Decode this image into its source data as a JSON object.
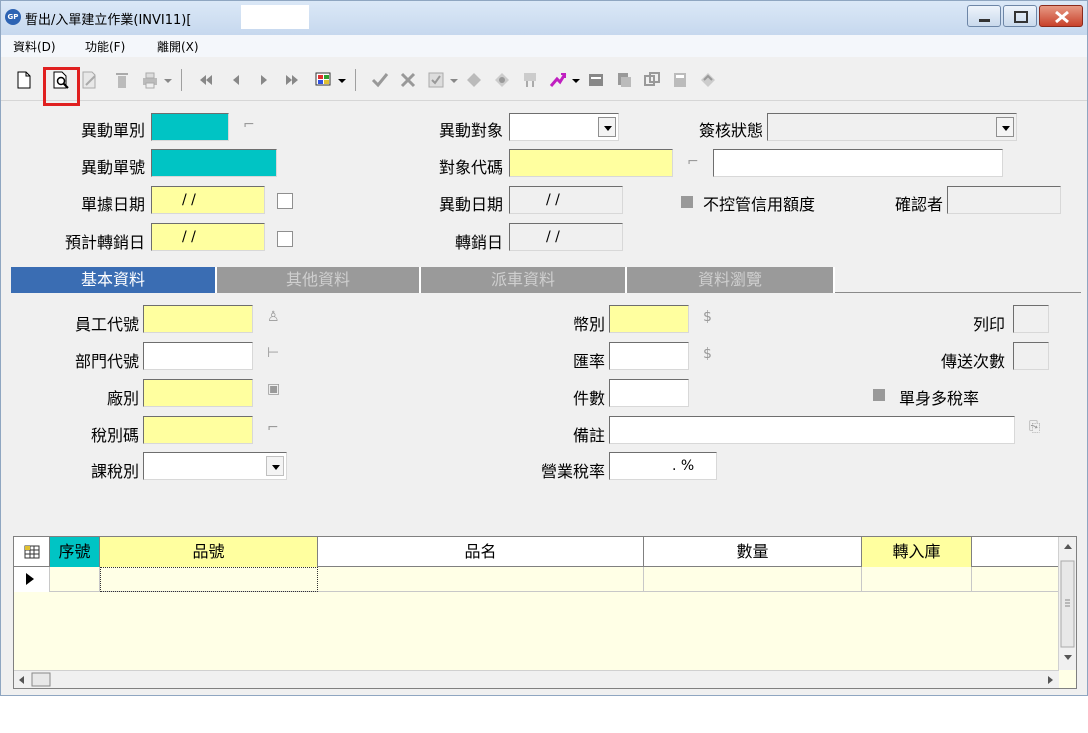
{
  "window": {
    "title": "暫出/入單建立作業(INVI11)[",
    "app_icon_text": "GP"
  },
  "menu": [
    "資料(D)",
    "功能(F)",
    "離開(X)"
  ],
  "toolbar": {
    "icons": [
      "new-doc-icon",
      "preview-icon",
      "edit-icon",
      "delete-icon",
      "print-icon",
      "first-icon",
      "prev-icon",
      "next-icon",
      "last-icon",
      "query-icon",
      "confirm-icon",
      "cancel-icon",
      "approve-icon",
      "copy-icon",
      "link-icon",
      "report-icon",
      "chart-icon",
      "export-icon",
      "import-icon",
      "window-icon",
      "tool-icon",
      "exit-icon"
    ]
  },
  "header_form": {
    "doc_type_label": "異動單別",
    "doc_no_label": "異動單號",
    "doc_date_label": "單據日期",
    "doc_date_value": "/  /",
    "expected_writeoff_label": "預計轉銷日",
    "expected_writeoff_value": "/  /",
    "target_label": "異動對象",
    "target_code_label": "對象代碼",
    "change_date_label": "異動日期",
    "change_date_value": "/  /",
    "writeoff_label": "轉銷日",
    "writeoff_value": "/  /",
    "approval_status_label": "簽核狀態",
    "no_credit_control_label": "不控管信用額度",
    "confirmer_label": "確認者"
  },
  "tabs": [
    "基本資料",
    "其他資料",
    "派車資料",
    "資料瀏覽"
  ],
  "basic_form": {
    "employee_code_label": "員工代號",
    "dept_code_label": "部門代號",
    "plant_label": "廠別",
    "tax_code_label": "稅別碼",
    "tax_type_label": "課稅別",
    "currency_label": "幣別",
    "exchange_rate_label": "匯率",
    "pieces_label": "件數",
    "remark_label": "備註",
    "sales_tax_rate_label": "營業稅率",
    "sales_tax_rate_value": ".   %",
    "print_label": "列印",
    "send_count_label": "傳送次數",
    "multi_tax_label": "單身多稅率"
  },
  "grid": {
    "columns": [
      "序號",
      "品號",
      "品名",
      "數量",
      "轉入庫"
    ]
  },
  "colors": {
    "required_cyan": "#00c4c4",
    "input_yellow": "#ffff9f",
    "active_tab": "#3a6db3",
    "highlight_red": "#e02020"
  }
}
